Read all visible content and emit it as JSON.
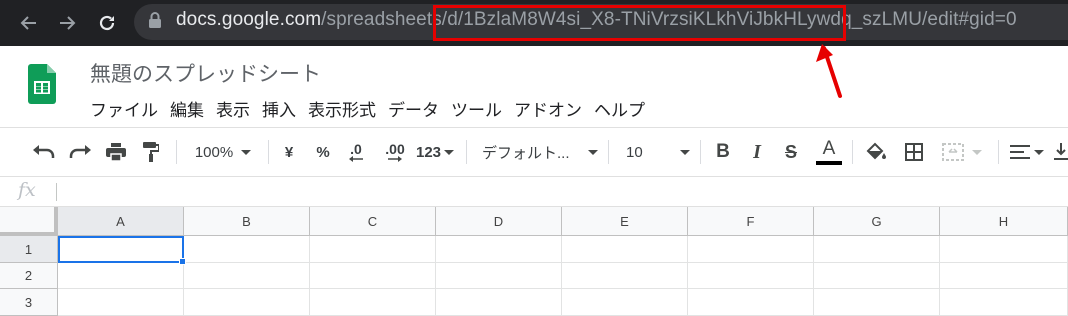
{
  "browser": {
    "url_host": "docs.google.com",
    "url_path_prefix": "/spreadsheets/d/",
    "url_doc_id": "1BzlaM8W4si_X8-TNiVrzsiKLkhViJbkHLywdq_szLMU",
    "url_suffix": "/edit#gid=0",
    "highlight_color": "#e60000"
  },
  "doc": {
    "title": "無題のスプレッドシート",
    "menu": [
      "ファイル",
      "編集",
      "表示",
      "挿入",
      "表示形式",
      "データ",
      "ツール",
      "アドオン",
      "ヘルプ"
    ]
  },
  "toolbar": {
    "zoom": "100%",
    "currency": "¥",
    "percent": "%",
    "dec_decrease": ".0",
    "dec_increase": ".00",
    "more_formats": "123",
    "font": "デフォルト...",
    "font_size": "10",
    "bold": "B",
    "italic": "I",
    "strikethrough": "S",
    "text_color_letter": "A"
  },
  "formula_bar": {
    "fx": "fx"
  },
  "grid": {
    "columns": [
      "A",
      "B",
      "C",
      "D",
      "E",
      "F",
      "G",
      "H"
    ],
    "rows": [
      "1",
      "2",
      "3"
    ],
    "active_cell": "A1",
    "accent": "#1a73e8"
  },
  "colors": {
    "chrome_bg": "#202124",
    "sheets_green": "#0f9d58"
  }
}
